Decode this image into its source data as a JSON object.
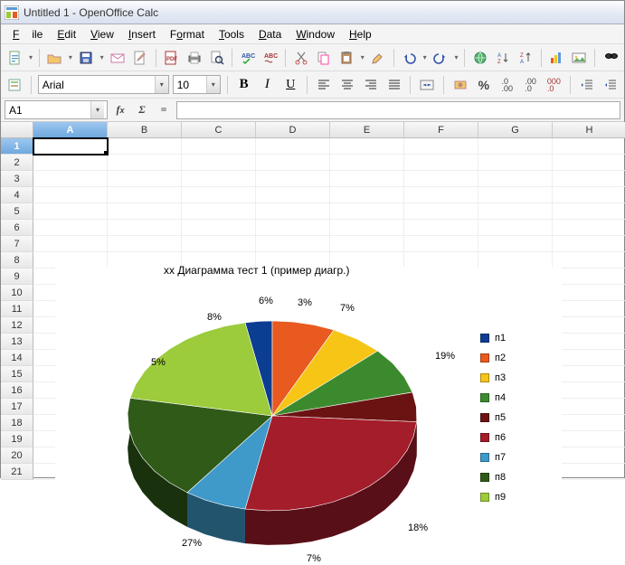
{
  "window": {
    "title": "Untitled 1 - OpenOffice Calc"
  },
  "menu": {
    "file": "File",
    "edit": "Edit",
    "view": "View",
    "insert": "Insert",
    "format": "Format",
    "tools": "Tools",
    "data": "Data",
    "window": "Window",
    "help": "Help"
  },
  "format": {
    "font": "Arial",
    "size": "10"
  },
  "formula": {
    "cellref": "A1",
    "eq": "="
  },
  "columns": [
    "A",
    "B",
    "C",
    "D",
    "E",
    "F",
    "G",
    "H"
  ],
  "rows": [
    "1",
    "2",
    "3",
    "4",
    "5",
    "6",
    "7",
    "8",
    "9",
    "10",
    "11",
    "12",
    "13",
    "14",
    "15",
    "16",
    "17",
    "18",
    "19",
    "20",
    "21"
  ],
  "chart_data": {
    "type": "pie",
    "title": "xx Диаграмма тест 1 (пример диагр.)",
    "series": [
      {
        "name": "п1",
        "value": 3,
        "label": "3%",
        "color": "#0b3d91"
      },
      {
        "name": "п2",
        "value": 7,
        "label": "7%",
        "color": "#e85a1f"
      },
      {
        "name": "п3",
        "value": 6,
        "label": "6%",
        "color": "#f6c516"
      },
      {
        "name": "п4",
        "value": 8,
        "label": "8%",
        "color": "#3c8a2e"
      },
      {
        "name": "п5",
        "value": 5,
        "label": "5%",
        "color": "#6b1313"
      },
      {
        "name": "п6",
        "value": 27,
        "label": "27%",
        "color": "#a31d2a"
      },
      {
        "name": "п7",
        "value": 7,
        "label": "7%",
        "color": "#3f99c9"
      },
      {
        "name": "п8",
        "value": 18,
        "label": "18%",
        "color": "#2f5a18"
      },
      {
        "name": "п9",
        "value": 19,
        "label": "19%",
        "color": "#9ccb3b"
      }
    ]
  }
}
